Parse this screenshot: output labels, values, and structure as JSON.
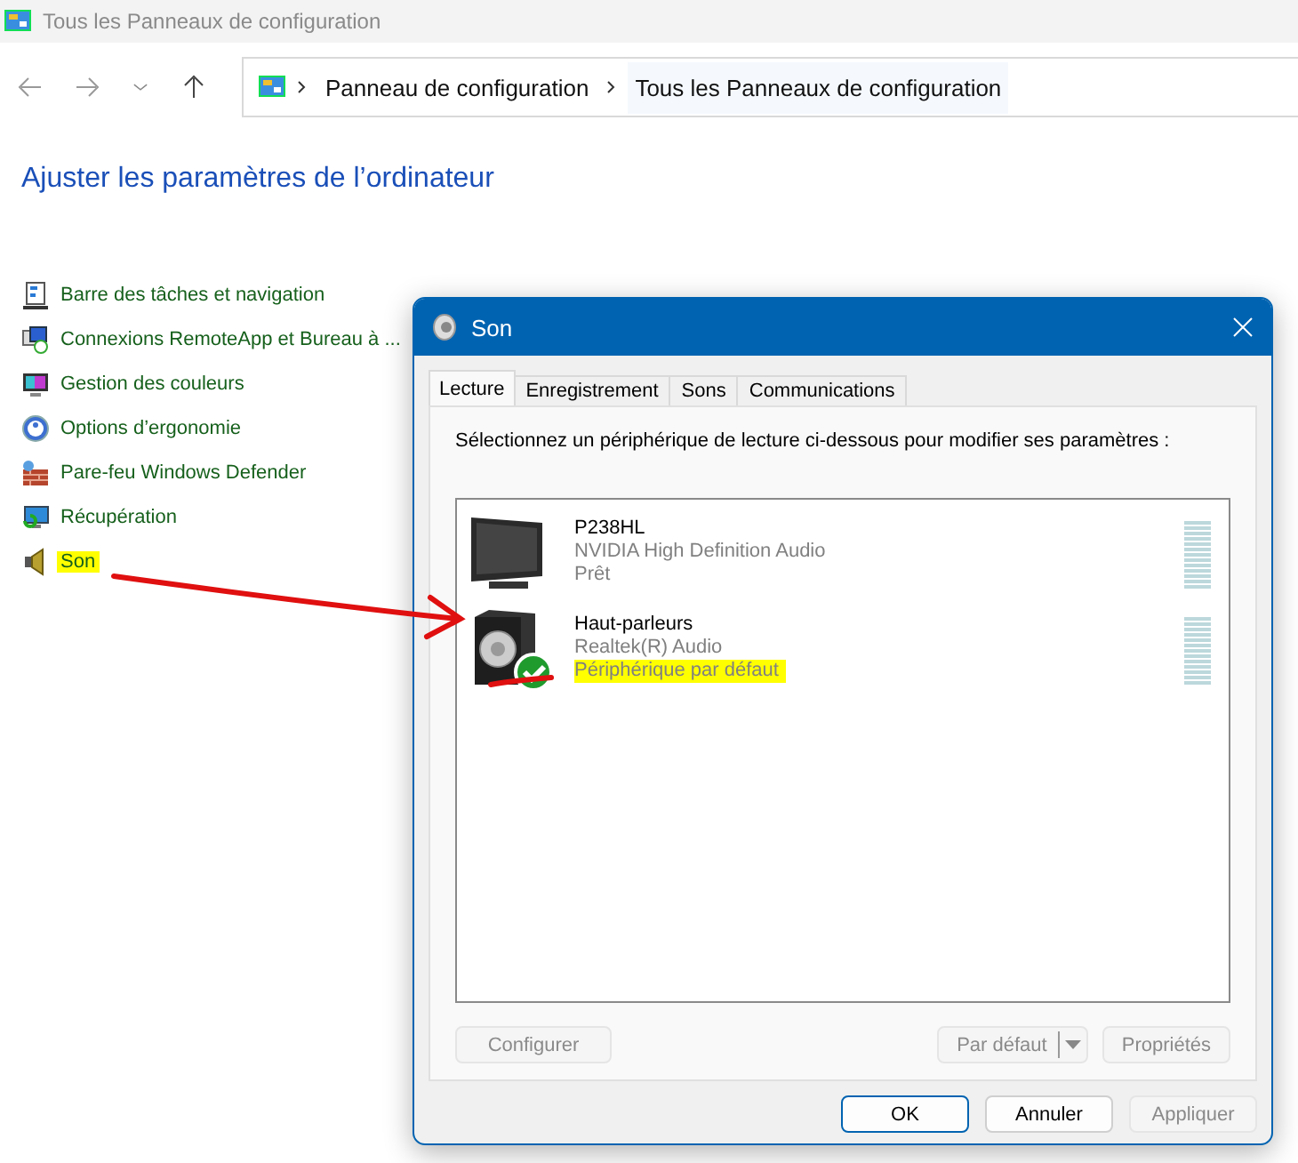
{
  "window": {
    "title": "Tous les Panneaux de configuration"
  },
  "breadcrumb": [
    "Panneau de configuration",
    "Tous les Panneaux de configuration"
  ],
  "heading": "Ajuster les paramètres de l’ordinateur",
  "items": [
    {
      "label": "Barre des tâches et navigation",
      "kind": "taskbar",
      "highlighted": false
    },
    {
      "label": "Connexions RemoteApp et Bureau à ...",
      "kind": "remote",
      "highlighted": false
    },
    {
      "label": "Gestion des couleurs",
      "kind": "color",
      "highlighted": false
    },
    {
      "label": "Options d’ergonomie",
      "kind": "access",
      "highlighted": false
    },
    {
      "label": "Pare-feu Windows Defender",
      "kind": "firewall",
      "highlighted": false
    },
    {
      "label": "Récupération",
      "kind": "recovery",
      "highlighted": false
    },
    {
      "label": "Son",
      "kind": "sound",
      "highlighted": true
    }
  ],
  "dialog": {
    "title": "Son",
    "tabs": [
      {
        "label": "Lecture",
        "selected": true
      },
      {
        "label": "Enregistrement",
        "selected": false
      },
      {
        "label": "Sons",
        "selected": false
      },
      {
        "label": "Communications",
        "selected": false
      }
    ],
    "instruction": "Sélectionnez un périphérique de lecture ci-dessous pour modifier ses paramètres :",
    "devices": [
      {
        "name": "P238HL",
        "driver": "NVIDIA High Definition Audio",
        "status": "Prêt",
        "kind": "monitor",
        "default": false,
        "highlighted": false
      },
      {
        "name": "Haut-parleurs",
        "driver": "Realtek(R) Audio",
        "status": "Périphérique par défaut",
        "kind": "speaker",
        "default": true,
        "highlighted": true
      }
    ],
    "configure": {
      "label": "Configurer",
      "disabled": true
    },
    "set_default": {
      "label": "Par défaut",
      "disabled": true
    },
    "properties": {
      "label": "Propriétés",
      "disabled": true
    },
    "footer": [
      {
        "label": "OK",
        "primary": true,
        "disabled": false
      },
      {
        "label": "Annuler",
        "primary": false,
        "disabled": false
      },
      {
        "label": "Appliquer",
        "primary": false,
        "disabled": true
      }
    ]
  },
  "annotation_arrow": true,
  "annotation_underline": true
}
